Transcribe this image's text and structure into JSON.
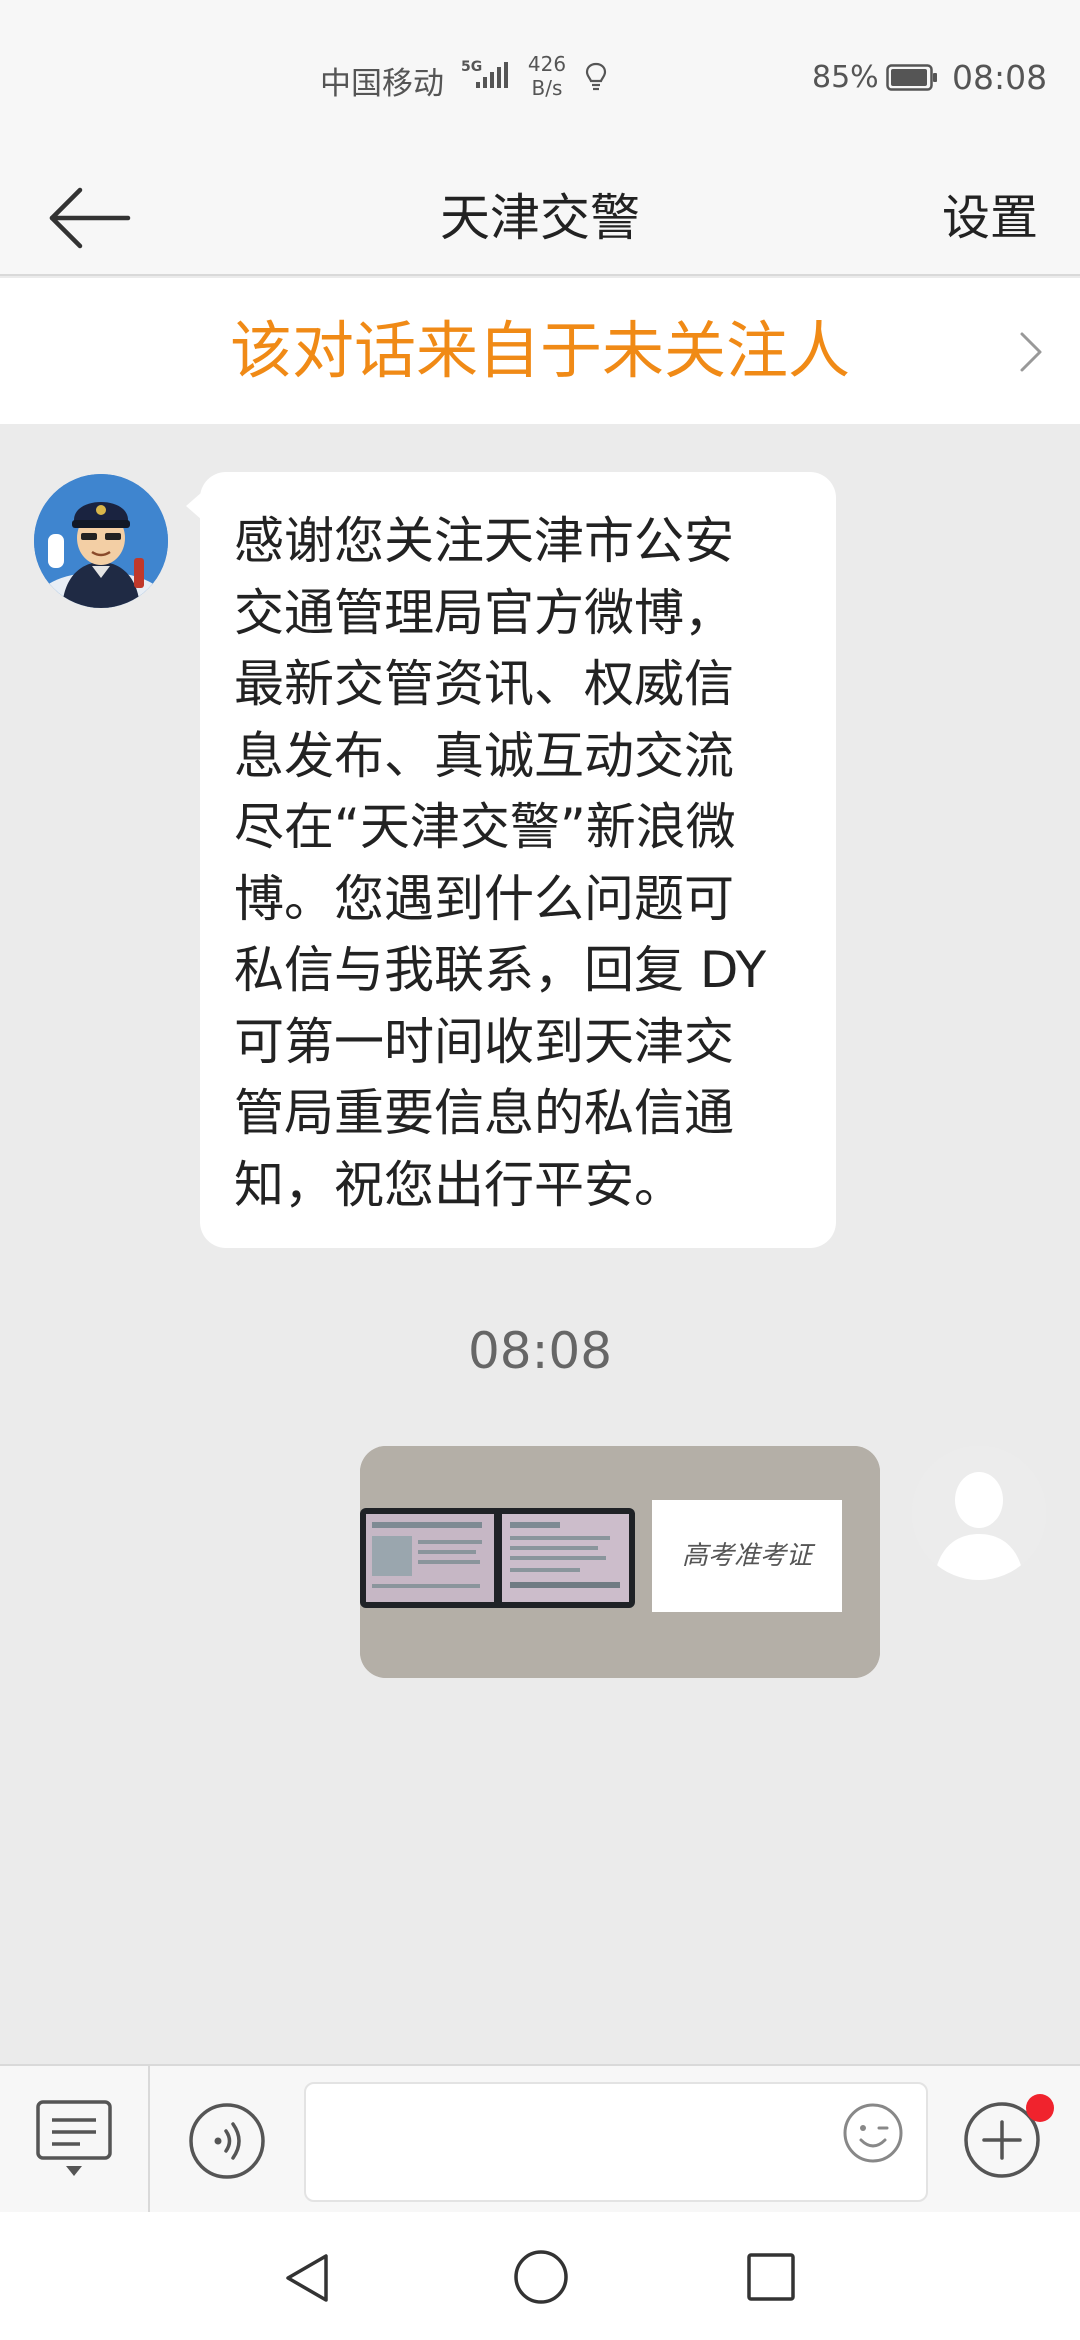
{
  "status_bar": {
    "carrier": "中国移动",
    "network_type": "5G",
    "net_speed_value": "426",
    "net_speed_unit": "B/s",
    "battery": "85%",
    "time": "08:08",
    "icons": [
      "signal-icon",
      "bulb-icon",
      "battery-icon"
    ]
  },
  "header": {
    "back_icon": "arrow-left-icon",
    "title": "天津交警",
    "settings_label": "设置"
  },
  "notice": {
    "text": "该对话来自于未关注人",
    "icon": "chevron-right-icon"
  },
  "conversation": {
    "incoming_message": "感谢您关注天津市公安\n交通管理局官方微博，\n最新交管资讯、权威信\n息发布、真诚互动交流\n尽在“天津交警”新浪微\n博。您遇到什么问题可\n私信与我联系，回复 DY\n可第一时间收到天津交\n管局重要信息的私信通\n知，祝您出行平安。",
    "timestamp": "08:08",
    "outgoing_image_caption": "高考准考证"
  },
  "input_bar": {
    "icons": [
      "menu-toggle-icon",
      "voice-icon",
      "emoji-icon",
      "plus-icon"
    ],
    "input_value": ""
  },
  "system_nav": {
    "icons": [
      "back-triangle-icon",
      "home-circle-icon",
      "recents-square-icon"
    ]
  },
  "colors": {
    "accent_orange": "#f08a16",
    "notify_red": "#f0232d",
    "chat_bg": "#ebebeb"
  }
}
